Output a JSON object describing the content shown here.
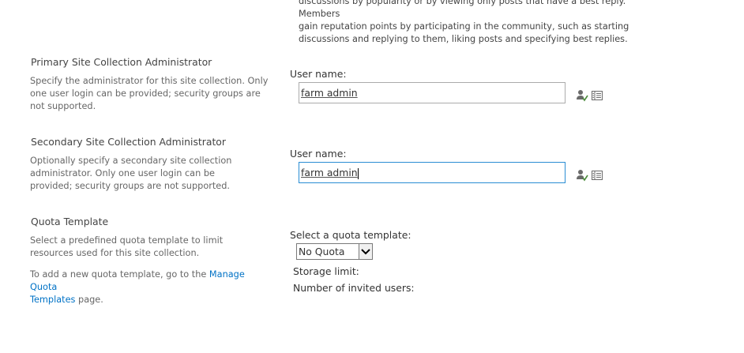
{
  "community_desc": {
    "line1": "discussions by popularity or by viewing only posts that have a best reply. Members",
    "line2": "gain reputation points by participating in the community, such as starting",
    "line3": "discussions and replying to them, liking posts and specifying best replies."
  },
  "primary_admin": {
    "title": "Primary Site Collection Administrator",
    "description": "Specify the administrator for this site collection. Only one user login can be provided; security groups are not supported.",
    "field_label": "User name:",
    "value": "farm admin",
    "check_icon": "check-names-icon",
    "browse_icon": "address-book-icon"
  },
  "secondary_admin": {
    "title": "Secondary Site Collection Administrator",
    "description": "Optionally specify a secondary site collection administrator. Only one user login can be provided; security groups are not supported.",
    "field_label": "User name:",
    "value": "farm admin",
    "check_icon": "check-names-icon",
    "browse_icon": "address-book-icon"
  },
  "quota": {
    "title": "Quota Template",
    "description": "Select a predefined quota template to limit resources used for this site collection.",
    "add_text_before": "To add a new quota template, go to the ",
    "add_link_part1": "Manage Quota",
    "add_link_part2": "Templates",
    "add_text_after": " page.",
    "select_label": "Select a quota template:",
    "selected": "No Quota",
    "storage_limit_label": "Storage limit:",
    "invited_users_label": "Number of invited users:"
  },
  "colors": {
    "link": "#0072c6",
    "focus_border": "#2a8dd4",
    "input_border": "#ababab"
  }
}
